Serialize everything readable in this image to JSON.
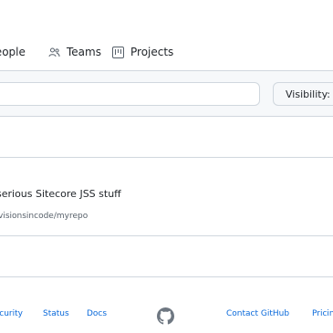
{
  "nav": {
    "people_label": "People",
    "teams_label": "Teams",
    "projects_label": "Projects"
  },
  "filters": {
    "search_placeholder": "",
    "visibility_label": "Visibility: All"
  },
  "repo": {
    "description": "serious Sitecore JSS stuff",
    "url": "visionsincode/myrepo"
  },
  "footer": {
    "security": "Security",
    "status": "Status",
    "docs": "Docs",
    "contact": "Contact GitHub",
    "pricing": "Pricing"
  },
  "icons": {
    "teams": "people-icon",
    "projects": "project-board-icon",
    "footer_logo": "github-mark-icon"
  },
  "colors": {
    "link": "#0969da",
    "border": "#d0d7de",
    "muted": "#57606a",
    "band": "#f6f8fa"
  }
}
